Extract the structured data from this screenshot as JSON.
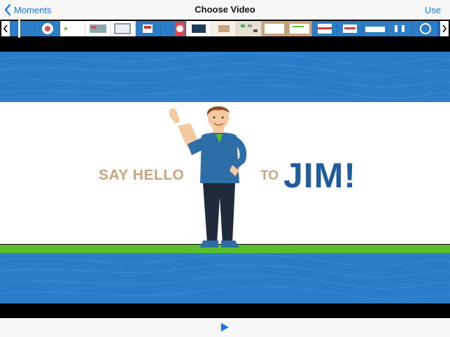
{
  "nav": {
    "back_label": "Moments",
    "title": "Choose Video",
    "use_label": "Use"
  },
  "video": {
    "headline_left": "SAY HELLO",
    "headline_to": "TO",
    "headline_name": "JIM!"
  },
  "colors": {
    "accent": "#1a73e8",
    "band_blue": "#2b7dc8",
    "green": "#5bbf2a",
    "text_tan": "#c8a57e",
    "text_blue": "#1e5c9c"
  },
  "icons": {
    "back": "chevron-left-icon",
    "trim_left": "trim-left-handle-icon",
    "trim_right": "trim-right-handle-icon",
    "play": "play-icon"
  }
}
